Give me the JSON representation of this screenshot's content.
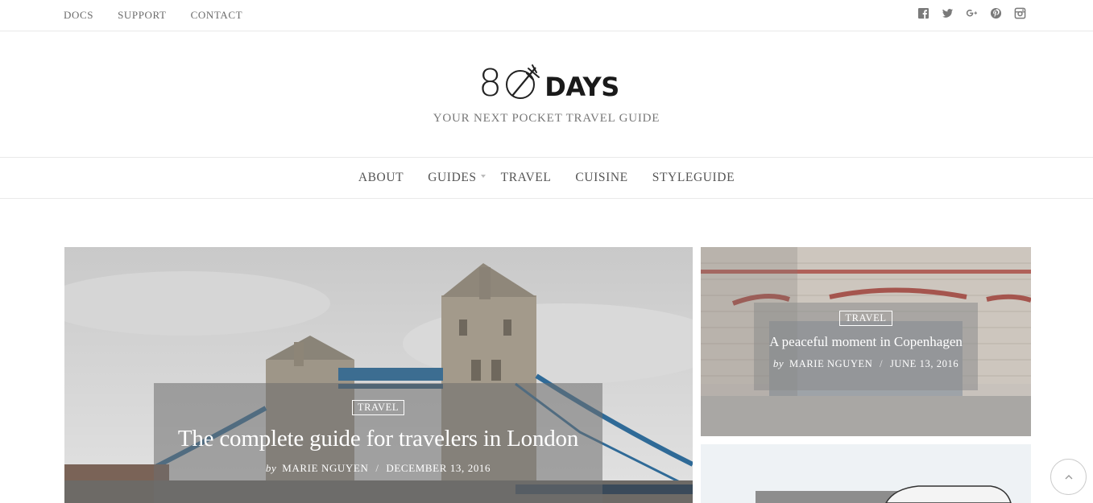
{
  "topbar": {
    "links": [
      "DOCS",
      "SUPPORT",
      "CONTACT"
    ],
    "social_icons": [
      "facebook-icon",
      "twitter-icon",
      "google-plus-icon",
      "pinterest-icon",
      "instagram-icon"
    ]
  },
  "logo": {
    "number": "8",
    "word": "DAYS",
    "tagline": "YOUR NEXT POCKET TRAVEL GUIDE"
  },
  "nav": {
    "items": [
      "ABOUT",
      "GUIDES",
      "TRAVEL",
      "CUISINE",
      "STYLEGUIDE"
    ]
  },
  "posts": [
    {
      "category": "TRAVEL",
      "title": "The complete guide for travelers in London",
      "by": "by",
      "author": "MARIE NGUYEN",
      "separator": "/",
      "date": "DECEMBER 13, 2016"
    },
    {
      "category": "TRAVEL",
      "title": "A peaceful moment in Copenhagen",
      "by": "by",
      "author": "MARIE NGUYEN",
      "separator": "/",
      "date": "JUNE 13, 2016"
    }
  ],
  "colors": {
    "text": "#333333",
    "muted": "#777777",
    "border": "#e9e9e9",
    "overlay": "#6e6e6e"
  }
}
